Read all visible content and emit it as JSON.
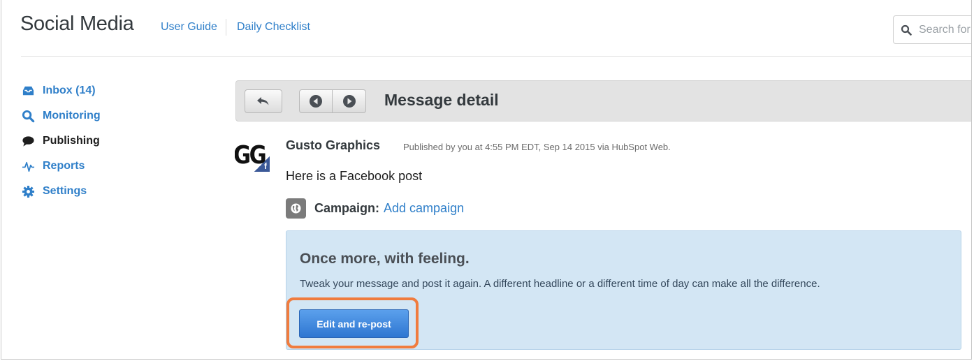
{
  "header": {
    "title": "Social Media",
    "links": [
      "User Guide",
      "Daily Checklist"
    ],
    "search_placeholder": "Search for"
  },
  "sidebar": {
    "items": [
      {
        "label": "Inbox (14)",
        "icon": "inbox-icon",
        "active": false
      },
      {
        "label": "Monitoring",
        "icon": "search-icon",
        "active": false
      },
      {
        "label": "Publishing",
        "icon": "speech-bubble-icon",
        "active": true
      },
      {
        "label": "Reports",
        "icon": "pulse-icon",
        "active": false
      },
      {
        "label": "Settings",
        "icon": "gear-icon",
        "active": false
      }
    ]
  },
  "toolbar": {
    "title": "Message detail",
    "back_icon": "reply-arrow-icon",
    "prev_icon": "circle-left-icon",
    "next_icon": "circle-right-icon"
  },
  "message": {
    "author": "Gusto Graphics",
    "avatar_text": "GG",
    "network_badge": "f",
    "meta": "Published by you at 4:55 PM EDT, Sep 14 2015 via HubSpot Web.",
    "text": "Here is a Facebook post",
    "campaign_label": "Campaign:",
    "campaign_link": "Add campaign"
  },
  "callout": {
    "title": "Once more, with feeling.",
    "text": "Tweak your message and post it again. A different headline or a different time of day can make all the difference.",
    "button_label": "Edit and re-post",
    "highlight_color": "#f07c3e"
  },
  "colors": {
    "link": "#2f7fc9",
    "callout_bg": "#d3e6f4",
    "button": "#2e76d1",
    "facebook": "#3b5998"
  }
}
